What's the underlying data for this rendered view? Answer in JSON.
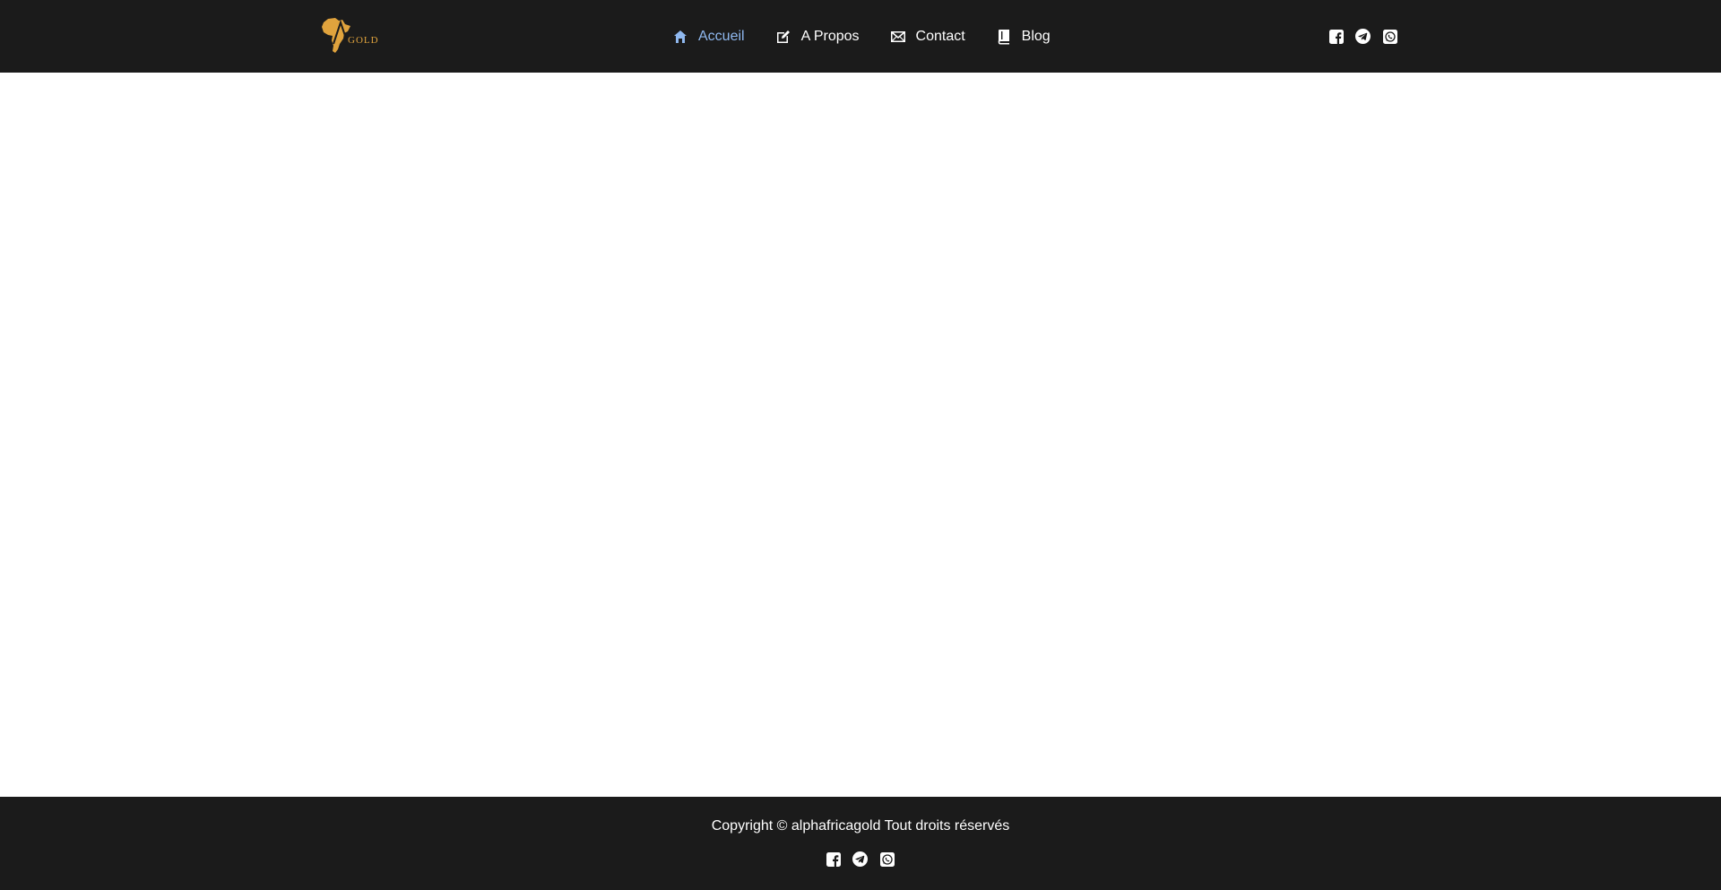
{
  "header": {
    "logo": {
      "text": "GOLD",
      "icon": "africa-map-logo",
      "color": "#e0a33d"
    },
    "nav": [
      {
        "label": "Accueil",
        "icon": "home-icon",
        "active": true
      },
      {
        "label": "A Propos",
        "icon": "edit-icon",
        "active": false
      },
      {
        "label": "Contact",
        "icon": "envelope-icon",
        "active": false
      },
      {
        "label": "Blog",
        "icon": "book-icon",
        "active": false
      }
    ],
    "social": [
      "facebook-icon",
      "telegram-icon",
      "whatsapp-icon"
    ]
  },
  "footer": {
    "copyright": "Copyright © alphafricagold Tout droits réservés",
    "social": [
      "facebook-icon",
      "telegram-icon",
      "whatsapp-icon"
    ]
  },
  "colors": {
    "bar_background": "#1b1b1b",
    "nav_active": "#8fb8ef",
    "nav_text": "#ffffff",
    "page_background": "#ffffff",
    "brand_gold": "#e0a33d"
  }
}
